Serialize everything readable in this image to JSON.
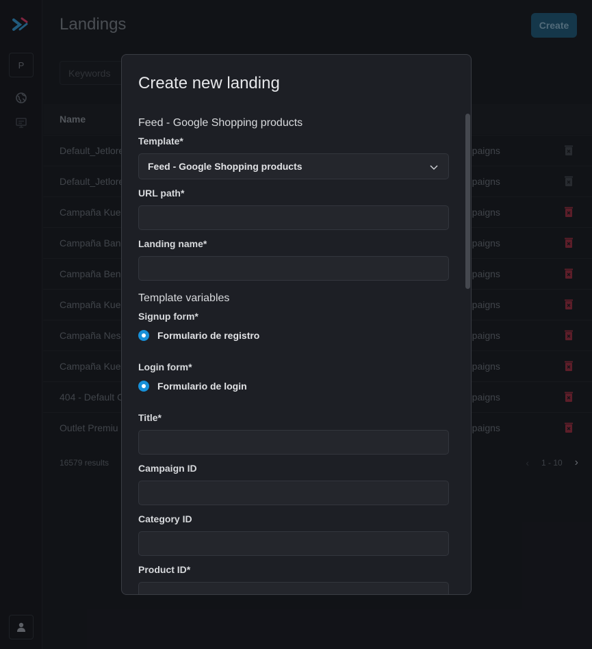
{
  "sidebar": {
    "project_initial": "P",
    "icons": [
      "globe-icon",
      "screen-icon"
    ],
    "user_icon": "user-icon"
  },
  "page": {
    "title": "Landings",
    "create_label": "Create",
    "search_placeholder": "Keywords",
    "column_name": "Name",
    "rows": [
      {
        "name": "Default_Jetlore",
        "type": "mpaigns"
      },
      {
        "name": "Default_Jetlore",
        "type": "mpaigns"
      },
      {
        "name": "Campaña Kuesk",
        "type": "mpaigns"
      },
      {
        "name": "Campaña Banc",
        "type": "mpaigns"
      },
      {
        "name": "Campaña Bena",
        "type": "mpaigns"
      },
      {
        "name": "Campaña Kuesk",
        "type": "mpaigns"
      },
      {
        "name": "Campaña Nesc",
        "type": "mpaigns"
      },
      {
        "name": "Campaña Kuesk",
        "type": "mpaigns"
      },
      {
        "name": "404 - Default C",
        "type": "mpaigns"
      },
      {
        "name": "Outlet Premiu",
        "type": "mpaigns"
      }
    ],
    "results": "16579 results",
    "pagination": "1 - 10"
  },
  "modal": {
    "title": "Create new landing",
    "section_title": "Feed - Google Shopping products",
    "template_label": "Template*",
    "template_value": "Feed - Google Shopping products",
    "url_path_label": "URL path*",
    "landing_name_label": "Landing name*",
    "variables_title": "Template variables",
    "signup_label": "Signup form*",
    "signup_option": "Formulario de registro",
    "login_label": "Login form*",
    "login_option": "Formulario de login",
    "title_label": "Title*",
    "campaign_label": "Campaign ID",
    "category_label": "Category ID",
    "product_label": "Product ID*"
  },
  "colors": {
    "accent": "#1790d8",
    "delete": "#8a2838",
    "create_button": "#1c4f6a"
  }
}
